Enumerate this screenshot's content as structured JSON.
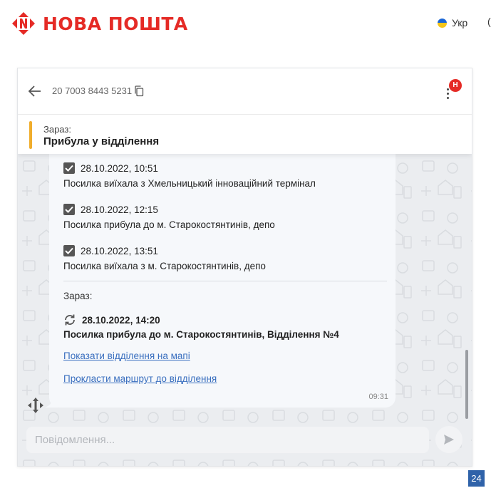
{
  "header": {
    "brand": "НОВА ПОШТА",
    "language": "Укр",
    "edge_text": "("
  },
  "chat": {
    "tracking_number": "20 7003 8443 5231",
    "menu_badge": "Н",
    "status": {
      "label": "Зараз:",
      "value": "Прибула у відділення",
      "accent": "#f0ad2c"
    },
    "events": [
      {
        "time": "28.10.2022, 10:51",
        "text": "Посилка виїхала з Хмельницький інноваційний термінал"
      },
      {
        "time": "28.10.2022, 12:15",
        "text": "Посилка прибула до м. Старокостянтинів, депо"
      },
      {
        "time": "28.10.2022, 13:51",
        "text": "Посилка виїхала з м. Старокостянтинів, депо"
      }
    ],
    "current": {
      "label": "Зараз:",
      "time": "28.10.2022, 14:20",
      "text": "Посилка прибула до м. Старокостянтинів, Відділення №4"
    },
    "links": {
      "show_map": "Показати відділення на мапі",
      "route": "Прокласти маршрут до відділення"
    },
    "message_time": "09:31",
    "composer_placeholder": "Повідомлення..."
  },
  "widget_label": "24",
  "colors": {
    "brand": "#e52b26",
    "link": "#3a6fbf",
    "widget": "#2f62a9"
  }
}
